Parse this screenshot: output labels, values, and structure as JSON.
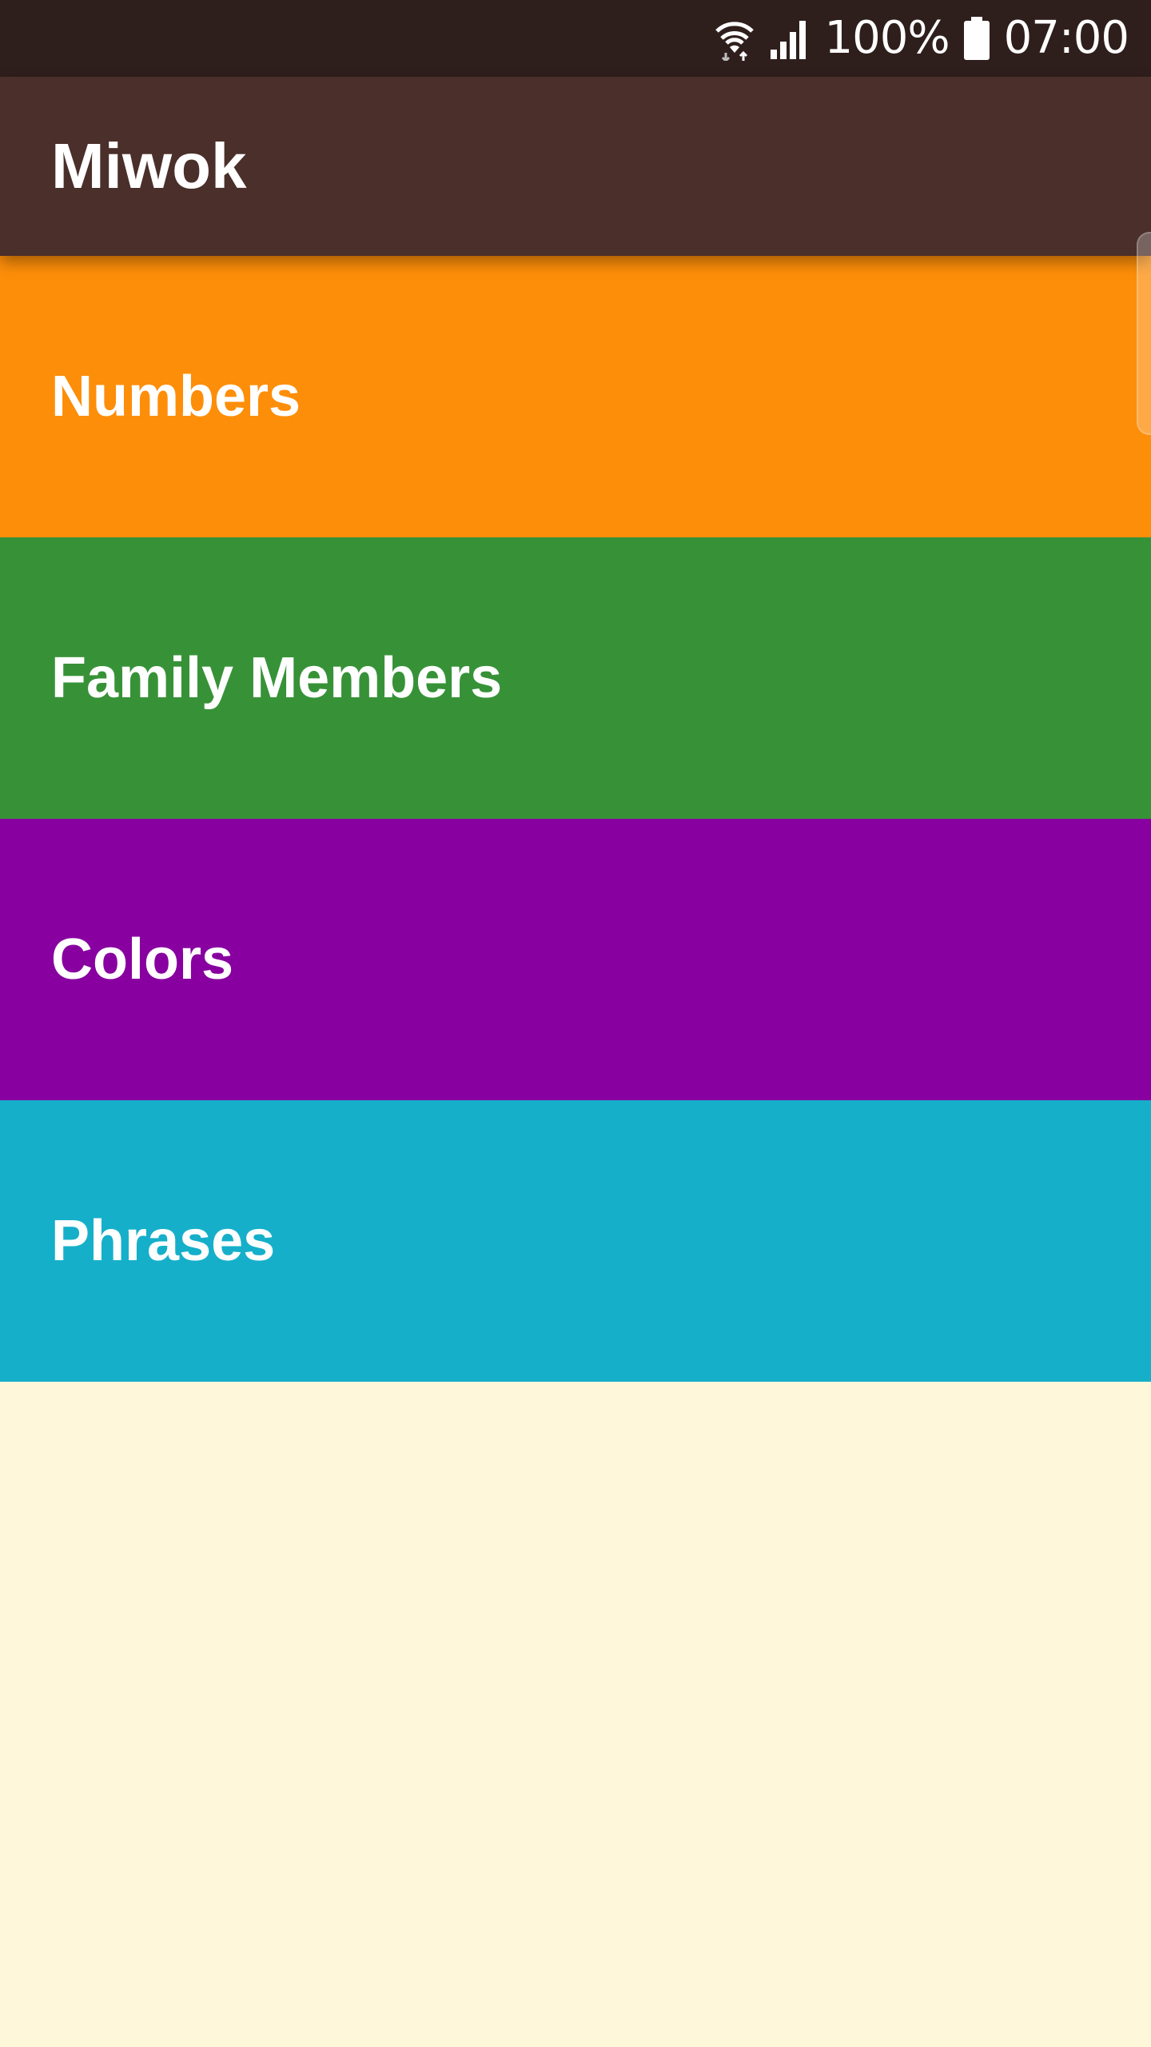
{
  "status_bar": {
    "battery_percent": "100%",
    "time": "07:00",
    "icons": [
      "wifi-icon",
      "signal-icon",
      "battery-icon"
    ],
    "background": "#2F1F1C"
  },
  "app_bar": {
    "title": "Miwok",
    "background": "#4A2F2A"
  },
  "categories": [
    {
      "label": "Numbers",
      "color": "#FD8E09"
    },
    {
      "label": "Family Members",
      "color": "#379237"
    },
    {
      "label": "Colors",
      "color": "#8800A0"
    },
    {
      "label": "Phrases",
      "color": "#16AFCA"
    }
  ],
  "background_color": "#FFF7DA"
}
